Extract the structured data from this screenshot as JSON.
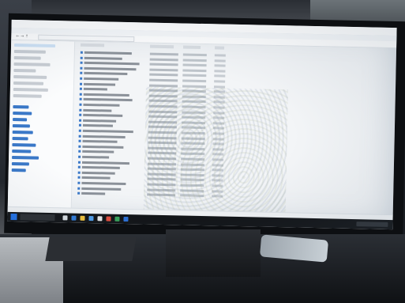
{
  "scene": {
    "description_visible": "",
    "window": {
      "title": "",
      "ribbon_tabs": [],
      "address_path": ""
    },
    "sidebar": {
      "items": []
    },
    "file_list": {
      "headers": [],
      "rows": []
    },
    "status": "",
    "taskbar": {
      "icons": [
        "start-icon",
        "search-box",
        "task-view-icon",
        "edge-icon",
        "folder-icon",
        "store-icon",
        "mail-icon",
        "chrome-icon",
        "word-icon",
        "excel-icon"
      ],
      "tray": ""
    }
  },
  "colors": {
    "accent": "#1f6fe5",
    "screen_bg": "#f3f5f7",
    "taskbar_bg": "#101215"
  }
}
